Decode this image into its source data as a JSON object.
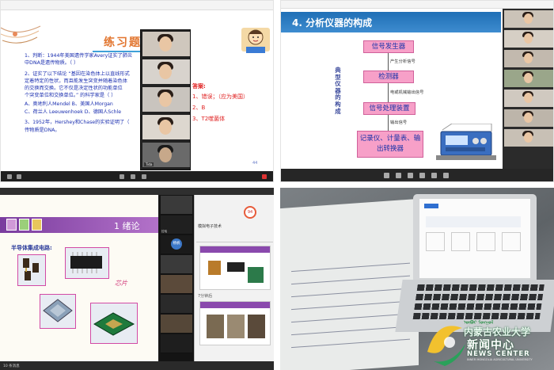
{
  "q1": {
    "title": "练习题",
    "questions": [
      "1、判断：1944年美国遗传学家Avery证实了肺炎",
      "中DNA是遗传物质。（    ）",
      "2、证实了以下结论 “基因在染色体上以直线形式",
      "定着特定的性状，而且能发生突变并随着染色体",
      "的交换而交换。它不仅是决定性状的功能单位",
      "个突变单位和交换单位。” 的科学家是（    ）",
      "A、奥地利人Mendel      B、美国人Morgan",
      "C、荷兰人 Leeuwenhoek    D、德国人Schle",
      "3、1952年，Hershey和Chase的实验证明了（",
      "传物质是DNA。"
    ],
    "answer_title": "答案:",
    "answers": [
      "1、错误；（应为美国）",
      "2、B",
      "3、T2噬菌体"
    ],
    "page_number": "44",
    "video_labels": [
      "",
      "",
      "",
      "",
      "Tida"
    ]
  },
  "q2": {
    "title": "4. 分析仪器的构成",
    "vertical_label": "典型仪器的构成",
    "boxes": [
      "信号发生器",
      "检测器",
      "信号处理装置",
      "记录仪、计量表、输出转换器"
    ],
    "signals": [
      "产生分析信号",
      "电或机械输出信号",
      "输出信号"
    ]
  },
  "q3": {
    "title": "1 绪论",
    "subtitle": "半导体集成电路:",
    "handwriting": "芯片",
    "panel_title": "模拟电子技术",
    "badge": "94",
    "panel_section": "7分钟后",
    "participants": [
      "",
      "拉哈",
      "",
      "",
      "",
      "",
      "",
      "",
      "",
      ""
    ],
    "avatar_text": "杨帆",
    "bottom_text": "10 条消息"
  },
  "q4": {
    "logo_mongolian": "ᠦᠪᠦᠷ ᠮᠣᠩᠭᠣᠯ",
    "logo_cn": "内蒙古农业大学",
    "logo_main": "新闻中心",
    "logo_en": "NEWS CENTER",
    "logo_sub": "INNER MONGOLIA AGRICULTURAL UNIVERSITY"
  }
}
